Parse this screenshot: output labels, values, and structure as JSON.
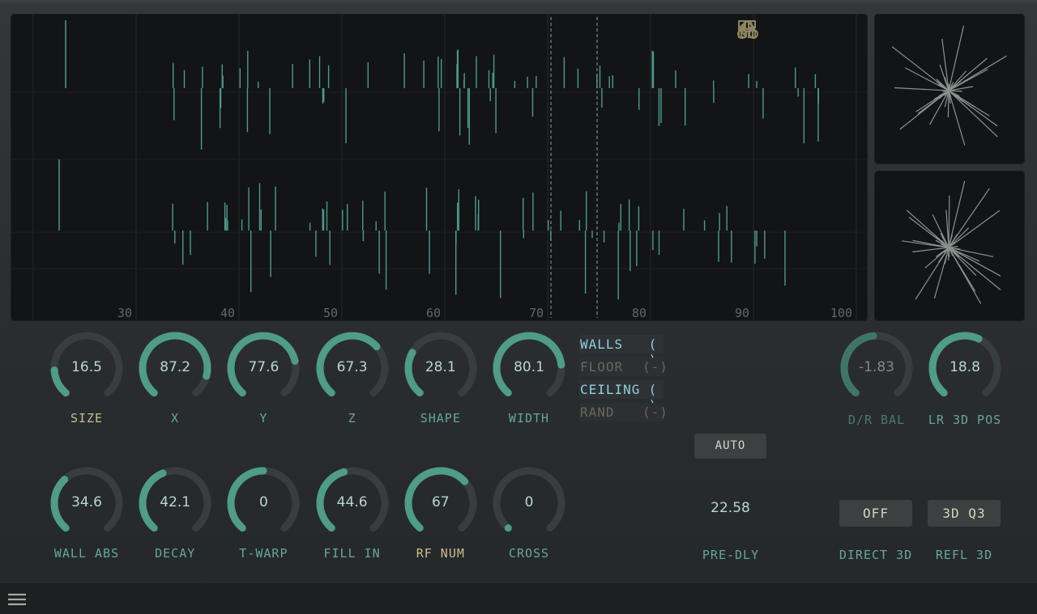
{
  "toolbar": {
    "icons": [
      "nodes-icon",
      "home-icon",
      "grid-icon",
      "back-arrow-icon"
    ]
  },
  "ir_display": {
    "tick_labels": [
      "30",
      "40",
      "50",
      "60",
      "70",
      "80",
      "90",
      "100"
    ]
  },
  "knobs_row1": [
    {
      "id": "size",
      "value": "16.5",
      "label": "SIZE",
      "fill": 0.165
    },
    {
      "id": "x",
      "value": "87.2",
      "label": "X",
      "fill": 0.872
    },
    {
      "id": "y",
      "value": "77.6",
      "label": "Y",
      "fill": 0.776
    },
    {
      "id": "z",
      "value": "67.3",
      "label": "Z",
      "fill": 0.673
    },
    {
      "id": "shape",
      "value": "28.1",
      "label": "SHAPE",
      "fill": 0.281
    },
    {
      "id": "width",
      "value": "80.1",
      "label": "WIDTH",
      "fill": 0.801
    }
  ],
  "knobs_row2": [
    {
      "id": "wall-abs",
      "value": "34.6",
      "label": "WALL ABS",
      "fill": 0.346
    },
    {
      "id": "decay",
      "value": "42.1",
      "label": "DECAY",
      "fill": 0.421
    },
    {
      "id": "t-warp",
      "value": "0",
      "label": "T-WARP",
      "fill": 0.5
    },
    {
      "id": "fill-in",
      "value": "44.6",
      "label": "FILL IN",
      "fill": 0.446
    },
    {
      "id": "rf-num",
      "value": "67",
      "label": "RF NUM",
      "fill": 0.67
    },
    {
      "id": "cross",
      "value": "0",
      "label": "CROSS",
      "fill": 0.0
    }
  ],
  "surfaces": [
    {
      "name": "WALLS",
      "state": "( )",
      "active": true
    },
    {
      "name": "FLOOR",
      "state": "(-)",
      "active": false
    },
    {
      "name": "CEILING",
      "state": "( )",
      "active": true
    },
    {
      "name": "RAND",
      "state": "(-)",
      "active": false
    }
  ],
  "auto_label": "AUTO",
  "predelay": {
    "value": "22.58",
    "label": "PRE-DLY"
  },
  "dr_bal": {
    "value": "-1.83",
    "label": "D/R BAL",
    "fill": 0.48
  },
  "lr_3d_pos": {
    "value": "18.8",
    "label": "LR 3D POS",
    "fill": 0.59
  },
  "direct_3d": {
    "value": "OFF",
    "label": "DIRECT 3D"
  },
  "refl_3d": {
    "value": "3D Q3",
    "label": "REFL 3D"
  },
  "colors": {
    "accent": "#4f9c88",
    "track": "#383d3f",
    "label": "#63a69a",
    "label_gold": "#c9bd8e",
    "surface_on": "#8fd0e0",
    "surface_off": "#6b675a"
  }
}
